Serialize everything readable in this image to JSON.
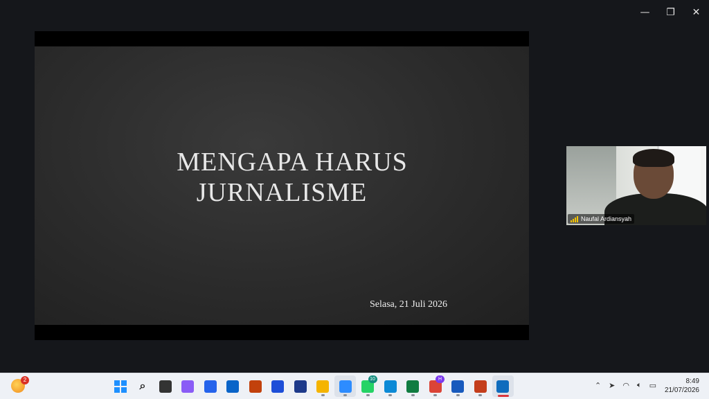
{
  "window_controls": {
    "minimize_icon": "minimize-icon",
    "restore_icon": "restore-icon",
    "close_icon": "close-icon"
  },
  "slide": {
    "title_line1": "MENGAPA HARUS",
    "title_line2": "JURNALISME",
    "date": "Selasa, 21 Juli 2026"
  },
  "participant": {
    "name": "Naufal Ardiansyah"
  },
  "taskbar": {
    "weather_badge": "2",
    "apps": [
      {
        "name": "start-button",
        "icon": "windows-icon",
        "color": "#1e90ff"
      },
      {
        "name": "search-button",
        "icon": "search-icon",
        "color": "#222222"
      },
      {
        "name": "task-view-button",
        "icon": "task-view-icon",
        "color": "#333333"
      },
      {
        "name": "copilot-app",
        "icon": "copilot-icon",
        "color": "#8a5cf6"
      },
      {
        "name": "store-app",
        "icon": "store-icon",
        "color": "#2563eb"
      },
      {
        "name": "outlook-app",
        "icon": "outlook-icon",
        "color": "#0a64c8"
      },
      {
        "name": "m365-app",
        "icon": "m365-icon",
        "color": "#c2410c"
      },
      {
        "name": "app-blue",
        "icon": "app-icon",
        "color": "#1d4ed8"
      },
      {
        "name": "app-hash",
        "icon": "hash-icon",
        "color": "#1e3a8a"
      },
      {
        "name": "file-explorer-app",
        "icon": "folder-icon",
        "color": "#f5b400"
      },
      {
        "name": "zoom-app",
        "icon": "zoom-icon",
        "color": "#2d8cff",
        "active": true
      },
      {
        "name": "whatsapp-app",
        "icon": "whatsapp-icon",
        "color": "#25d366",
        "badge": "10"
      },
      {
        "name": "edge-app",
        "icon": "edge-icon",
        "color": "#0c8ad6"
      },
      {
        "name": "excel-app",
        "icon": "excel-icon",
        "color": "#107c41"
      },
      {
        "name": "chrome-app",
        "icon": "chrome-icon",
        "color": "#db4437",
        "badge": "H"
      },
      {
        "name": "word-app",
        "icon": "word-icon",
        "color": "#185abd"
      },
      {
        "name": "powerpoint-app",
        "icon": "powerpoint-icon",
        "color": "#c43e1c"
      },
      {
        "name": "snipping-tool-app",
        "icon": "snip-icon",
        "color": "#0f6cbd",
        "active": true
      }
    ],
    "time": "8:49",
    "date": "21/07/2026"
  }
}
